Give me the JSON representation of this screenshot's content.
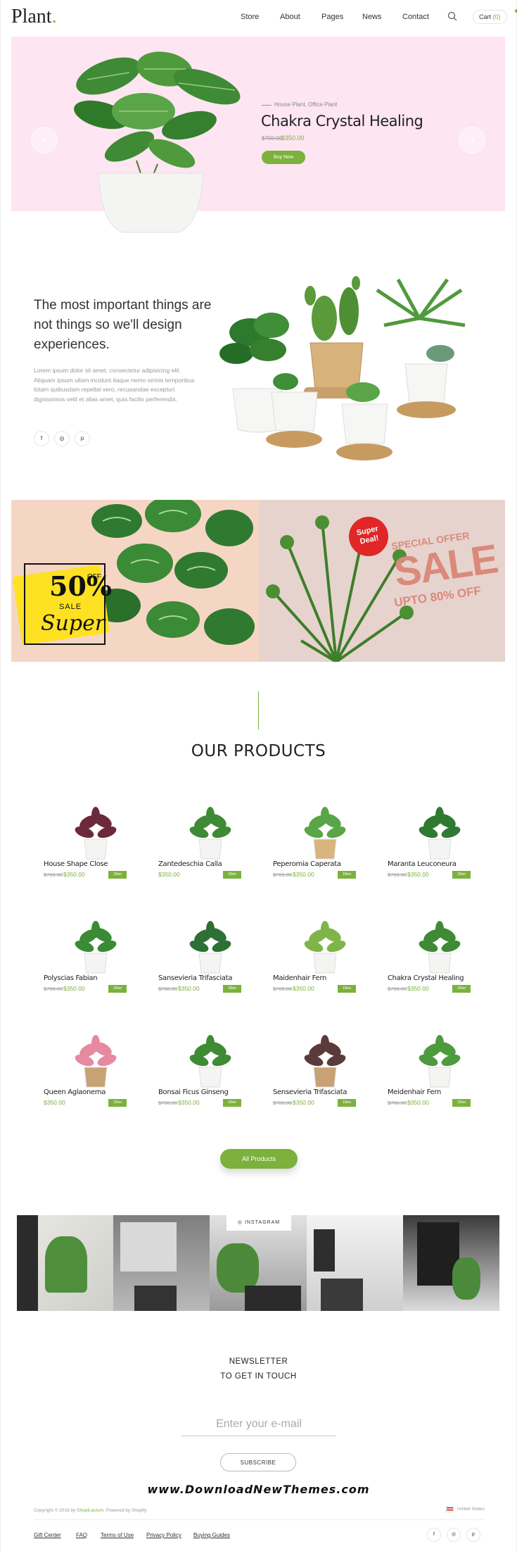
{
  "brand": {
    "logo": "Plant",
    "logo_dot": "."
  },
  "nav": [
    "Store",
    "About",
    "Pages",
    "News",
    "Contact"
  ],
  "cart": {
    "label": "Cart",
    "count": "(0)"
  },
  "hero": {
    "category": "House Plant, Office Plant",
    "title": "Chakra Crystal Healing",
    "old_price": "$700.00",
    "price": "$350.00",
    "button": "Buy Now",
    "prev_icon": "chevron-left-icon",
    "next_icon": "chevron-right-icon"
  },
  "about": {
    "heading": "The most important things are not things so we'll design experiences.",
    "text": "Lorem ipsum dolor sit amet, consectetur adipisicing elit. Aliquam ipsum ullam incidunt itaque nemo omnis temporibus totam quibusdam repellat vero, recusandae excepturi dignissimos velit et alias amet, quia facilis perferendis.",
    "social": [
      "f",
      "◎",
      "p"
    ]
  },
  "banners": {
    "left": {
      "percent": "50%",
      "off": "OFF",
      "sale": "SALE",
      "super": "Super"
    },
    "right": {
      "badge_line1": "Super",
      "badge_line2": "Deal!",
      "special": "SPECIAL OFFER",
      "sale": "SALE",
      "upto": "UPTO 80% OFF"
    }
  },
  "products_section": {
    "title": "OUR PRODUCTS",
    "tag": "10km",
    "items": [
      {
        "name": "House Shape Close",
        "old": "$700.00",
        "price": "$350.00"
      },
      {
        "name": "Zantedeschia Calla",
        "old": "",
        "price": "$350.00"
      },
      {
        "name": "Peperomia Caperata",
        "old": "$700.00",
        "price": "$350.00"
      },
      {
        "name": "Maranta Leuconeura",
        "old": "$700.00",
        "price": "$350.00"
      },
      {
        "name": "Polyscias Fabian",
        "old": "$700.00",
        "price": "$350.00"
      },
      {
        "name": "Sansevieria Trifasciata",
        "old": "$700.00",
        "price": "$350.00"
      },
      {
        "name": "Maidenhair Fern",
        "old": "$700.00",
        "price": "$350.00"
      },
      {
        "name": "Chakra Crystal Healing",
        "old": "$700.00",
        "price": "$350.00"
      },
      {
        "name": "Queen Aglaonema",
        "old": "",
        "price": "$350.00"
      },
      {
        "name": "Bonsai Ficus Ginseng",
        "old": "$700.00",
        "price": "$350.00"
      },
      {
        "name": "Sensevieria Trifasciata",
        "old": "$700.00",
        "price": "$350.00"
      },
      {
        "name": "Meidenhair Fern",
        "old": "$700.00",
        "price": "$350.00"
      }
    ],
    "all_button": "All Products"
  },
  "instagram": {
    "label": "INSTAGRAM"
  },
  "newsletter": {
    "title_line1": "NEWSLETTER",
    "title_line2": "TO GET IN TOUCH",
    "placeholder": "Enter your e-mail",
    "button": "SUBSCRIBE"
  },
  "watermark": "www.DownloadNewThemes.com",
  "footer": {
    "copyright_prefix": "Copyright © 2018 by",
    "copyright_brand": "ShopiLaunch",
    "copyright_suffix": ". Powered by Shopify",
    "region": "United States",
    "links": [
      "Gift Center",
      "FAQ",
      "Terms of Use",
      "Privacy Policy",
      "Buying Guides"
    ],
    "social": [
      "f",
      "◎",
      "p"
    ]
  },
  "colors": {
    "accent": "#7bb13c",
    "hero_bg": "#fde5f1",
    "sale_yellow": "#ffe123",
    "sale_pink": "#d98a7b"
  }
}
